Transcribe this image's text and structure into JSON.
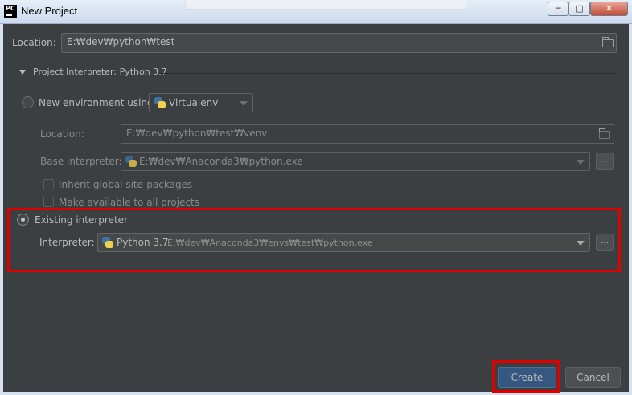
{
  "window": {
    "title": "New Project",
    "app_icon_text": "PC"
  },
  "location": {
    "label": "Location:",
    "value": "E:₩dev₩python₩test"
  },
  "interpreter_section": {
    "title": "Project Interpreter: Python 3.7"
  },
  "new_env": {
    "label": "New environment using",
    "tool": "Virtualenv",
    "location_label": "Location:",
    "location_value": "E:₩dev₩python₩test₩venv",
    "base_label": "Base interpreter:",
    "base_value": "E:₩dev₩Anaconda3₩python.exe",
    "inherit_label": "Inherit global site-packages",
    "available_label": "Make available to all projects",
    "ellipsis": "..."
  },
  "existing": {
    "label": "Existing interpreter",
    "interpreter_label": "Interpreter:",
    "interpreter_name": "Python 3.7",
    "interpreter_path": "E:₩dev₩Anaconda3₩envs₩test₩python.exe",
    "ellipsis": "..."
  },
  "buttons": {
    "create": "Create",
    "cancel": "Cancel"
  },
  "colors": {
    "accent": "#365880",
    "highlight": "#e00000",
    "background": "#3c3f41"
  }
}
